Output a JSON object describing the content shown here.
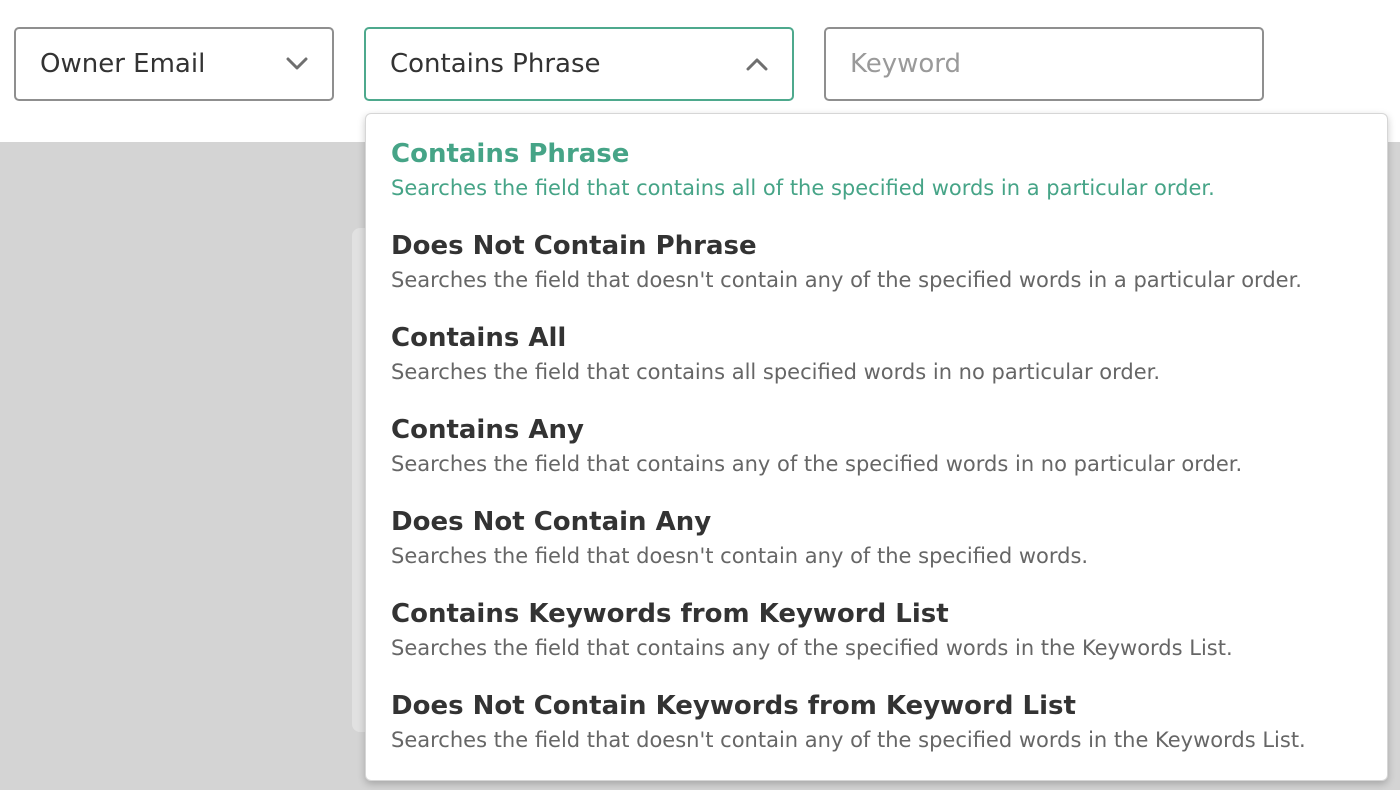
{
  "filters": {
    "field_select": {
      "value": "Owner Email",
      "icon": "chevron-down-icon"
    },
    "operator_select": {
      "value": "Contains Phrase",
      "icon": "chevron-up-icon",
      "expanded": true
    },
    "keyword_input": {
      "value": "",
      "placeholder": "Keyword"
    }
  },
  "dropdown": {
    "selected_index": 0,
    "options": [
      {
        "title": "Contains Phrase",
        "description": "Searches the field that contains all of the specified words in a particular order."
      },
      {
        "title": "Does Not Contain Phrase",
        "description": "Searches the field that doesn't contain any of the specified words in a particular order."
      },
      {
        "title": "Contains All",
        "description": "Searches the field that contains all specified words in no particular order."
      },
      {
        "title": "Contains Any",
        "description": "Searches the field that contains any of the specified words in no particular order."
      },
      {
        "title": "Does Not Contain Any",
        "description": "Searches the field that doesn't contain any of the specified words."
      },
      {
        "title": "Contains Keywords from Keyword List",
        "description": "Searches the field that contains any of the specified words in the Keywords List."
      },
      {
        "title": "Does Not Contain Keywords from Keyword List",
        "description": "Searches the field that doesn't contain any of the specified words in the Keywords List."
      }
    ]
  },
  "colors": {
    "accent": "#46a487",
    "border": "#8f8f8f",
    "backdrop": "#d4d4d4",
    "text": "#333333",
    "muted_text": "#666666"
  }
}
